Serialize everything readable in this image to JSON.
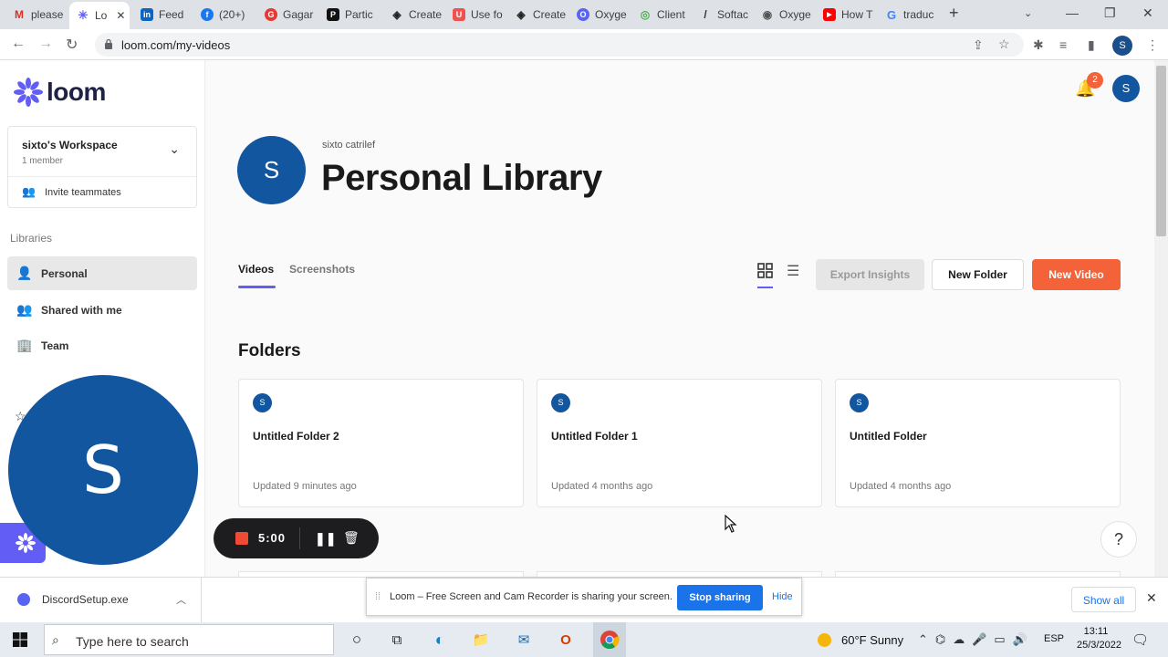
{
  "browser": {
    "tabs": [
      {
        "label": "please",
        "color": "#ffffff",
        "glyph": "M"
      },
      {
        "label": "Lo",
        "color": "#625df5",
        "glyph": "✳"
      },
      {
        "label": "Feed",
        "color": "#0a66c2",
        "glyph": "in"
      },
      {
        "label": "(20+)",
        "color": "#1877f2",
        "glyph": "f"
      },
      {
        "label": "Gagar",
        "color": "#e53935",
        "glyph": "G"
      },
      {
        "label": "Partic",
        "color": "#111111",
        "glyph": "P"
      },
      {
        "label": "Create",
        "color": "#222222",
        "glyph": "◈"
      },
      {
        "label": "Use fo",
        "color": "#ef5350",
        "glyph": "U"
      },
      {
        "label": "Create",
        "color": "#222222",
        "glyph": "◈"
      },
      {
        "label": "Oxyge",
        "color": "#5865f2",
        "glyph": "O"
      },
      {
        "label": "Client",
        "color": "#ffffff",
        "glyph": "◎"
      },
      {
        "label": "Softac",
        "color": "#ffffff",
        "glyph": "/"
      },
      {
        "label": "Oxyge",
        "color": "#555555",
        "glyph": "◉"
      },
      {
        "label": "How T",
        "color": "#ff0000",
        "glyph": "▶"
      },
      {
        "label": "traduc",
        "color": "#ffffff",
        "glyph": "G"
      }
    ],
    "url": "loom.com/my-videos",
    "profile_initial": "S"
  },
  "sidebar": {
    "logo": "loom",
    "workspace": {
      "name": "sixto's Workspace",
      "members": "1 member",
      "invite": "Invite teammates"
    },
    "libraries_heading": "Libraries",
    "items": [
      {
        "label": "Personal",
        "icon": "person-icon"
      },
      {
        "label": "Shared with me",
        "icon": "people-icon"
      },
      {
        "label": "Team",
        "icon": "building-icon"
      }
    ]
  },
  "camera_bubble": {
    "initial": "S"
  },
  "recording": {
    "time": "5:00"
  },
  "header": {
    "notification_count": "2",
    "user_initial": "S"
  },
  "library": {
    "owner": "sixto catrilef",
    "title": "Personal Library",
    "avatar_initial": "S",
    "tabs": [
      "Videos",
      "Screenshots"
    ],
    "buttons": {
      "export": "Export Insights",
      "new_folder": "New Folder",
      "new_video": "New Video"
    }
  },
  "folders": {
    "heading": "Folders",
    "items": [
      {
        "name": "Untitled Folder 2",
        "updated": "Updated 9 minutes ago",
        "avatar": "S"
      },
      {
        "name": "Untitled Folder 1",
        "updated": "Updated 4 months ago",
        "avatar": "S"
      },
      {
        "name": "Untitled Folder",
        "updated": "Updated 4 months ago",
        "avatar": "S"
      }
    ]
  },
  "help": "?",
  "share_notice": {
    "message": "Loom – Free Screen and Cam Recorder is sharing your screen.",
    "stop": "Stop sharing",
    "hide": "Hide"
  },
  "downloads": {
    "file": "DiscordSetup.exe",
    "show_all": "Show all"
  },
  "taskbar": {
    "search_placeholder": "Type here to search",
    "weather": "60°F  Sunny",
    "language": "ESP",
    "time": "13:11",
    "date": "25/3/2022"
  },
  "colors": {
    "brand": "#625df5",
    "accent": "#f4623a",
    "avatar": "#1256a0"
  }
}
